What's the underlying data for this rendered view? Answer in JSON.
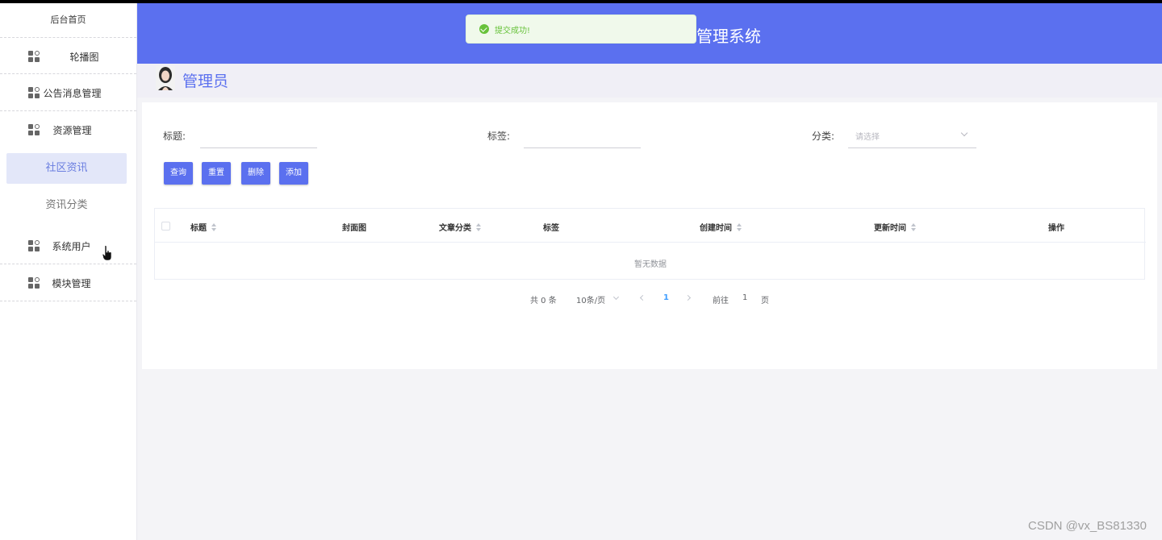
{
  "colors": {
    "primary": "#5b70ef",
    "success": "#67c23a",
    "link": "#409eff"
  },
  "sidebar": {
    "home": "后台首页",
    "items": [
      {
        "label": "轮播图",
        "icon": "grid-icon"
      },
      {
        "label": "公告消息管理",
        "icon": "grid-icon"
      },
      {
        "label": "资源管理",
        "icon": "grid-icon"
      }
    ],
    "subitems": [
      {
        "label": "社区资讯",
        "active": true
      },
      {
        "label": "资讯分类",
        "active": false
      }
    ],
    "items2": [
      {
        "label": "系统用户",
        "icon": "grid-icon"
      },
      {
        "label": "模块管理",
        "icon": "grid-icon"
      }
    ]
  },
  "header": {
    "title": "管理系统"
  },
  "toast": {
    "message": "提交成功!"
  },
  "user": {
    "name": "管理员"
  },
  "filters": {
    "title_label": "标题:",
    "tag_label": "标签:",
    "category_label": "分类:",
    "category_placeholder": "请选择"
  },
  "buttons": {
    "query": "查询",
    "reset": "重置",
    "delete": "删除",
    "add": "添加"
  },
  "table": {
    "columns": [
      "标题",
      "封面图",
      "文章分类",
      "标签",
      "创建时间",
      "更新时间",
      "操作"
    ],
    "empty_text": "暂无数据"
  },
  "pagination": {
    "total": "共 0 条",
    "page_size": "10条/页",
    "current_page": "1",
    "goto_label": "前往",
    "goto_value": "1",
    "page_suffix": "页"
  },
  "watermark": "CSDN @vx_BS81330"
}
